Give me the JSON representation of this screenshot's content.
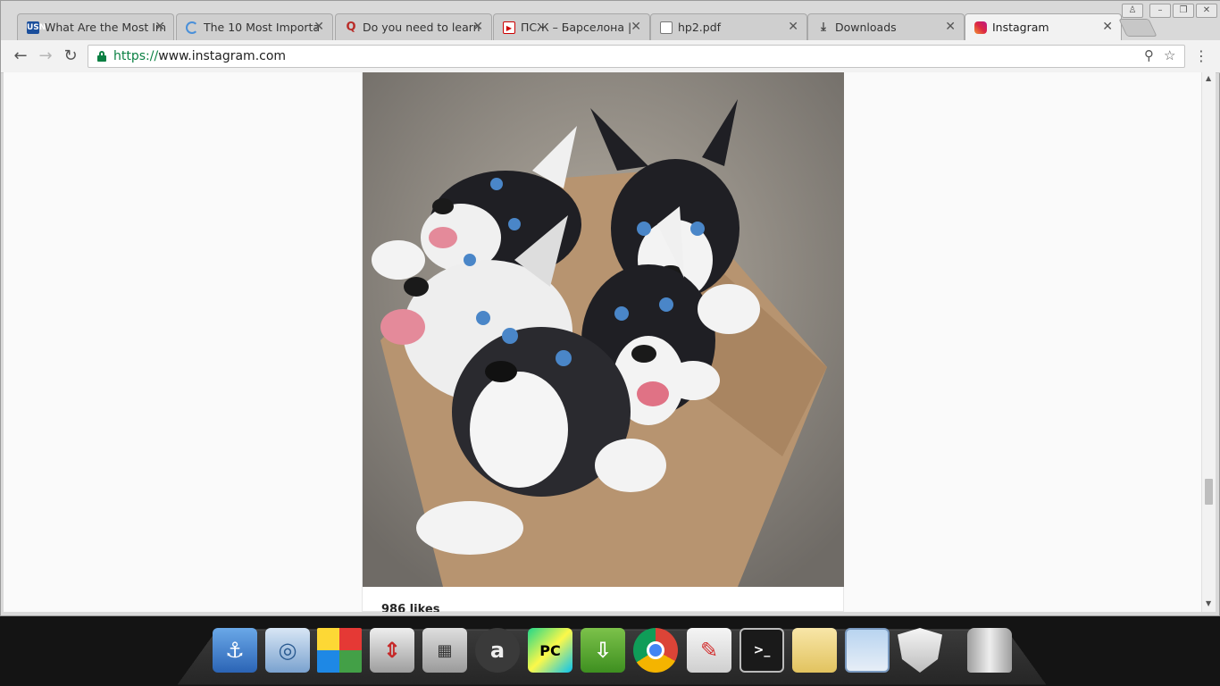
{
  "tabs": [
    {
      "title": "What Are the Most Im",
      "favicon": "USN"
    },
    {
      "title": "The 10 Most Importa",
      "favicon": "spinner"
    },
    {
      "title": "Do you need to learn",
      "favicon": "Q"
    },
    {
      "title": "ПСЖ – Барселона |",
      "favicon": "play"
    },
    {
      "title": "hp2.pdf",
      "favicon": "doc"
    },
    {
      "title": "Downloads",
      "favicon": "download"
    },
    {
      "title": "Instagram",
      "favicon": "instagram",
      "active": true
    }
  ],
  "omnibox": {
    "scheme": "https://",
    "host": "www.instagram.com"
  },
  "post": {
    "likes": "986 likes"
  },
  "dock": [
    "anchor-icon",
    "swirl-app-icon",
    "color-cubes-icon",
    "up-down-arrows-icon",
    "calculator-icon",
    "a-circle-icon",
    "pycharm-icon",
    "download-green-icon",
    "chrome-icon",
    "pdf-reader-icon",
    "terminal-icon",
    "folder-icon",
    "window-icon",
    "shield-icon",
    "trash-icon"
  ],
  "colors": {
    "secure": "#0b8043",
    "tab_active": "#f2f2f2",
    "tab_inactive": "#cfcfcf"
  }
}
